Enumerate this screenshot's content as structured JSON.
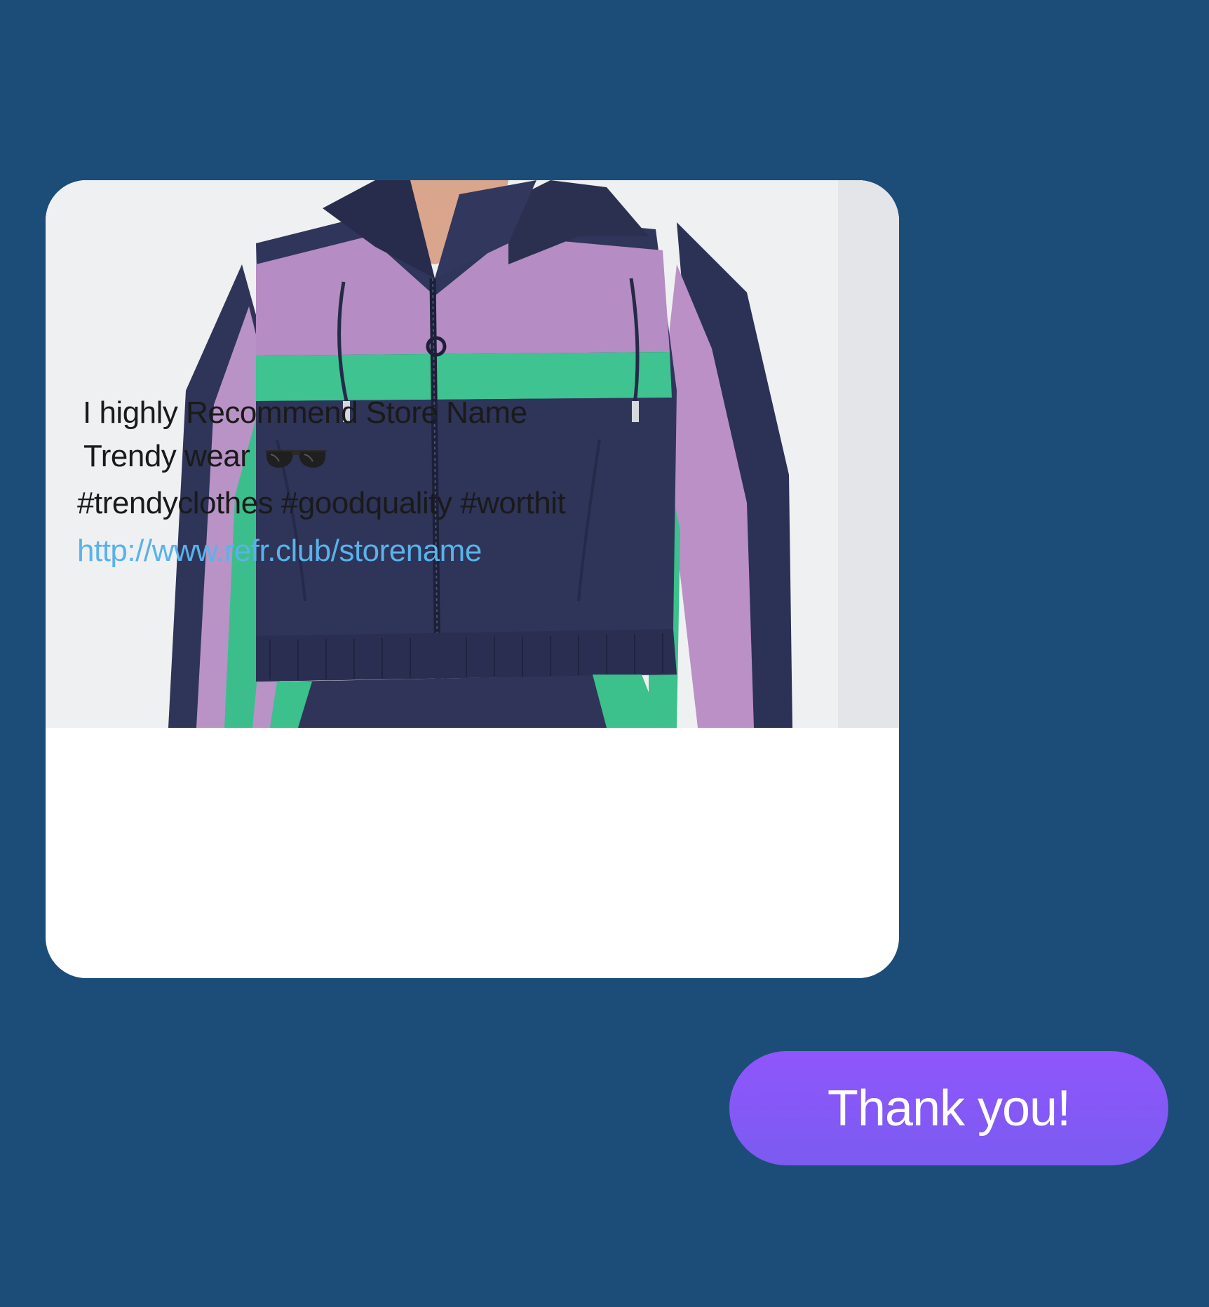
{
  "post": {
    "image_subject": "color-block windbreaker jacket",
    "caption_line1": "I highly Recommend Store Name",
    "caption_line2": "Trendy wear",
    "caption_emoji": "sunglasses-icon",
    "hashtags": "#trendyclothes #goodquality #worthit",
    "link": "http://www.refr.club/storename"
  },
  "reply": {
    "text": "Thank you!"
  },
  "colors": {
    "background": "#1c4d79",
    "card": "#ffffff",
    "link": "#5ab2ea",
    "reply_bubble": "#8a57f8",
    "jacket_navy": "#2e3358",
    "jacket_lilac": "#b98fc4",
    "jacket_green": "#3fc08f"
  }
}
